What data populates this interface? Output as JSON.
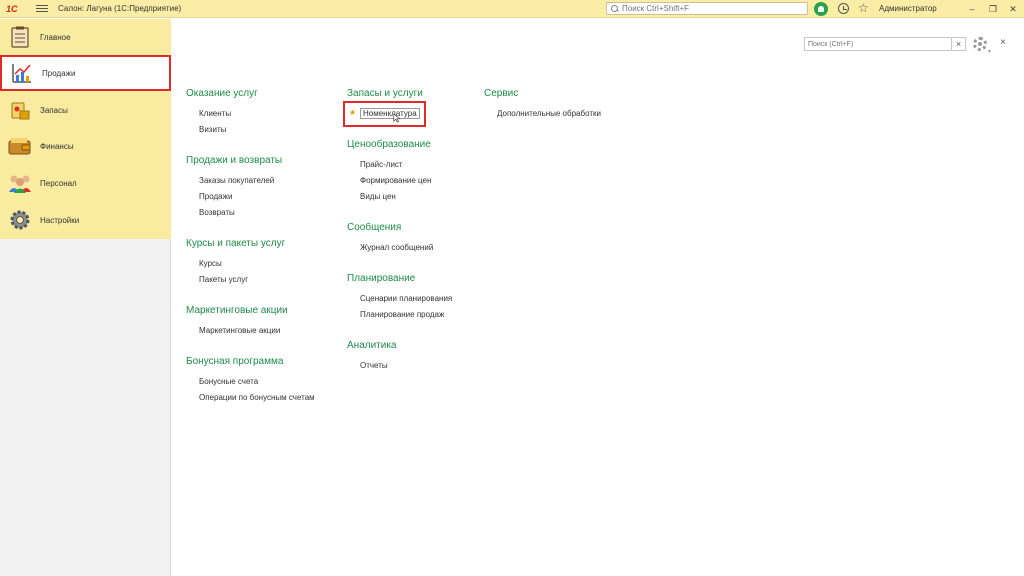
{
  "topbar": {
    "logo": "1С",
    "title": "Салон: Лагуна  (1С:Предприятие)",
    "search_placeholder": "Поиск Ctrl+Shift+F",
    "user": "Администратор",
    "minimize": "–",
    "restore": "❐",
    "close": "✕"
  },
  "sidebar": {
    "items": [
      {
        "label": "Главное",
        "icon": "checklist-icon"
      },
      {
        "label": "Продажи",
        "icon": "sales-chart-icon"
      },
      {
        "label": "Запасы",
        "icon": "inventory-icon"
      },
      {
        "label": "Финансы",
        "icon": "wallet-icon"
      },
      {
        "label": "Персонал",
        "icon": "people-icon"
      },
      {
        "label": "Настройки",
        "icon": "settings-gear-icon"
      }
    ],
    "active_index": 1
  },
  "content": {
    "search_placeholder": "Поиск (Ctrl+F)",
    "clear": "×",
    "close": "×",
    "columns": [
      {
        "groups": [
          {
            "title": "Оказание услуг",
            "links": [
              "Клиенты",
              "Визиты"
            ]
          },
          {
            "title": "Продажи и возвраты",
            "links": [
              "Заказы покупателей",
              "Продажи",
              "Возвраты"
            ]
          },
          {
            "title": "Курсы и пакеты услуг",
            "links": [
              "Курсы",
              "Пакеты услуг"
            ]
          },
          {
            "title": "Маркетинговые акции",
            "links": [
              "Маркетинговые акции"
            ]
          },
          {
            "title": "Бонусная программа",
            "links": [
              "Бонусные счета",
              "Операции по бонусным счетам"
            ]
          }
        ]
      },
      {
        "groups": [
          {
            "title": "Запасы и услуги",
            "links": [
              "Номенклатура"
            ]
          },
          {
            "title": "Ценообразование",
            "links": [
              "Прайс-лист",
              "Формирование цен",
              "Виды цен"
            ]
          },
          {
            "title": "Сообщения",
            "links": [
              "Журнал сообщений"
            ]
          },
          {
            "title": "Планирование",
            "links": [
              "Сценарии планирования",
              "Планирование продаж"
            ]
          },
          {
            "title": "Аналитика",
            "links": [
              "Отчеты"
            ]
          }
        ]
      },
      {
        "groups": [
          {
            "title": "Сервис",
            "links": [
              "Дополнительные обработки"
            ]
          }
        ]
      }
    ]
  },
  "colors": {
    "accent_green": "#1f8a4c",
    "sidebar_yellow": "#f9eba0",
    "highlight_red": "#e02b2b",
    "favorite_star": "#e0a000"
  }
}
